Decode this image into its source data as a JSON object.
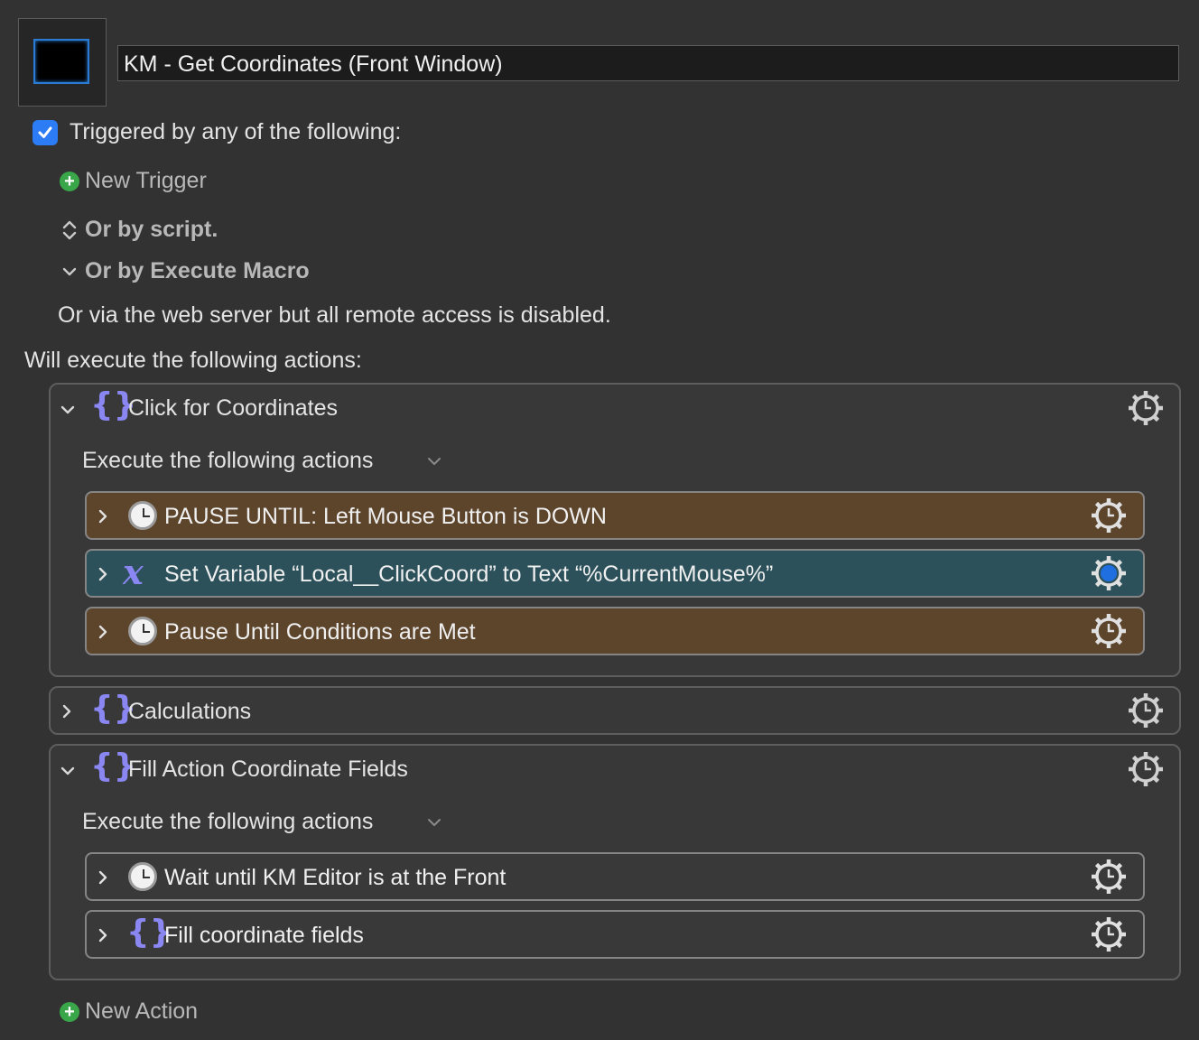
{
  "macro": {
    "title": "KM - Get Coordinates (Front Window)"
  },
  "triggers": {
    "enabled_label": "Triggered by any of the following:",
    "new_trigger": "New Trigger",
    "or_script": "Or by script.",
    "or_execute": "Or by Execute Macro",
    "web_server": "Or via the web server but all remote access is disabled."
  },
  "actions_header": "Will execute the following actions:",
  "groups": [
    {
      "title": "Click for Coordinates",
      "subtitle": "Execute the following actions",
      "actions": [
        {
          "label": "PAUSE UNTIL:  Left Mouse Button is DOWN"
        },
        {
          "label": "Set Variable “Local__ClickCoord” to Text “%CurrentMouse%”"
        },
        {
          "label": "Pause Until Conditions are Met"
        }
      ]
    },
    {
      "title": "Calculations"
    },
    {
      "title": "Fill Action Coordinate Fields",
      "subtitle": "Execute the following actions",
      "actions": [
        {
          "label": "Wait until KM Editor is at the Front"
        },
        {
          "label": "Fill coordinate fields"
        }
      ]
    }
  ],
  "new_action": "New Action",
  "colors": {
    "background": "#323232",
    "pause_bar": "#5d452c",
    "variable_bar": "#2c515a",
    "accent_blue": "#2c7cf6",
    "braces": "#8a86f2",
    "add_green": "#3aa64a"
  },
  "icons": [
    "macro-icon-well",
    "checkbox-checked",
    "plus-icon",
    "updown-chevron-icon",
    "chevron-down-icon",
    "chevron-right-icon",
    "braces-icon",
    "clock-icon",
    "variable-x-icon",
    "gear-icon"
  ]
}
